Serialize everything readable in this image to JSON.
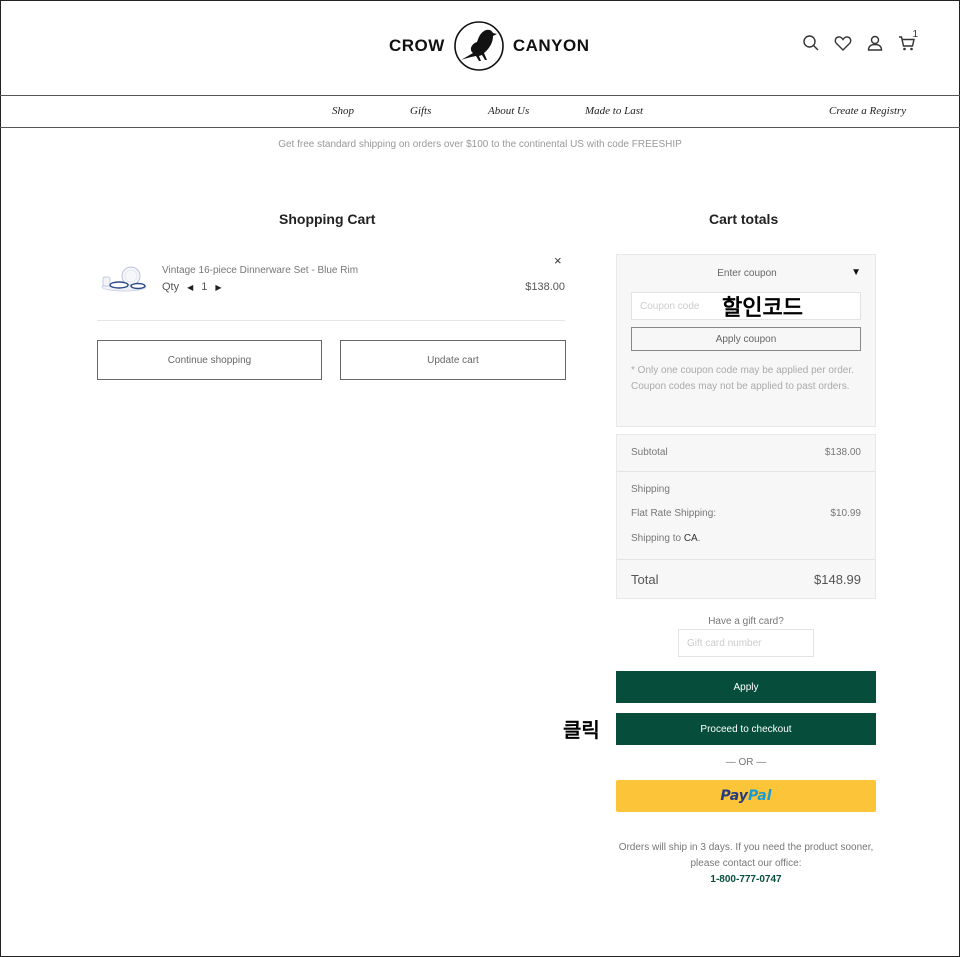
{
  "brand": {
    "word_left": "CROW",
    "word_right": "CANYON"
  },
  "header": {
    "cart_count": "1",
    "icons": [
      "search-icon",
      "heart-icon",
      "user-icon",
      "cart-icon"
    ]
  },
  "nav": {
    "shop": "Shop",
    "gifts": "Gifts",
    "about": "About Us",
    "made": "Made to Last",
    "registry": "Create a Registry"
  },
  "promo": "Get free standard shipping on orders over $100 to the continental US with code FREESHIP",
  "cart": {
    "title": "Shopping Cart",
    "item": {
      "name": "Vintage 16-piece Dinnerware Set - Blue Rim",
      "qty_label": "Qty",
      "qty": "1",
      "price": "$138.00",
      "remove": "×"
    },
    "continue_label": "Continue shopping",
    "update_label": "Update cart"
  },
  "totals": {
    "title": "Cart totals",
    "coupon": {
      "header": "Enter coupon",
      "toggle": "▼",
      "placeholder": "Coupon code",
      "apply_label": "Apply coupon",
      "note": "* Only one coupon code may be applied per order. Coupon codes may not be applied to past orders."
    },
    "subtotal_label": "Subtotal",
    "subtotal": "$138.00",
    "shipping_label": "Shipping",
    "flat_rate_label": "Flat Rate Shipping:",
    "flat_rate": "$10.99",
    "shipping_to_prefix": "Shipping to",
    "shipping_to_region": "CA",
    "shipping_to_suffix": ".",
    "total_label": "Total",
    "total": "$148.99"
  },
  "gift": {
    "label": "Have a gift card?",
    "placeholder": "Gift card number",
    "apply_label": "Apply"
  },
  "checkout": {
    "label": "Proceed to checkout",
    "or": "— OR —",
    "paypal_a": "Pay",
    "paypal_b": "Pal"
  },
  "ship_note": {
    "text": "Orders will ship in 3 days. If you need the product sooner, please contact our office:",
    "phone": "1-800-777-0747"
  },
  "annotations": {
    "coupon_code": "할인코드",
    "click": "클릭"
  },
  "colors": {
    "brand_green": "#064e3b",
    "paypal_yellow": "#fcc439"
  }
}
